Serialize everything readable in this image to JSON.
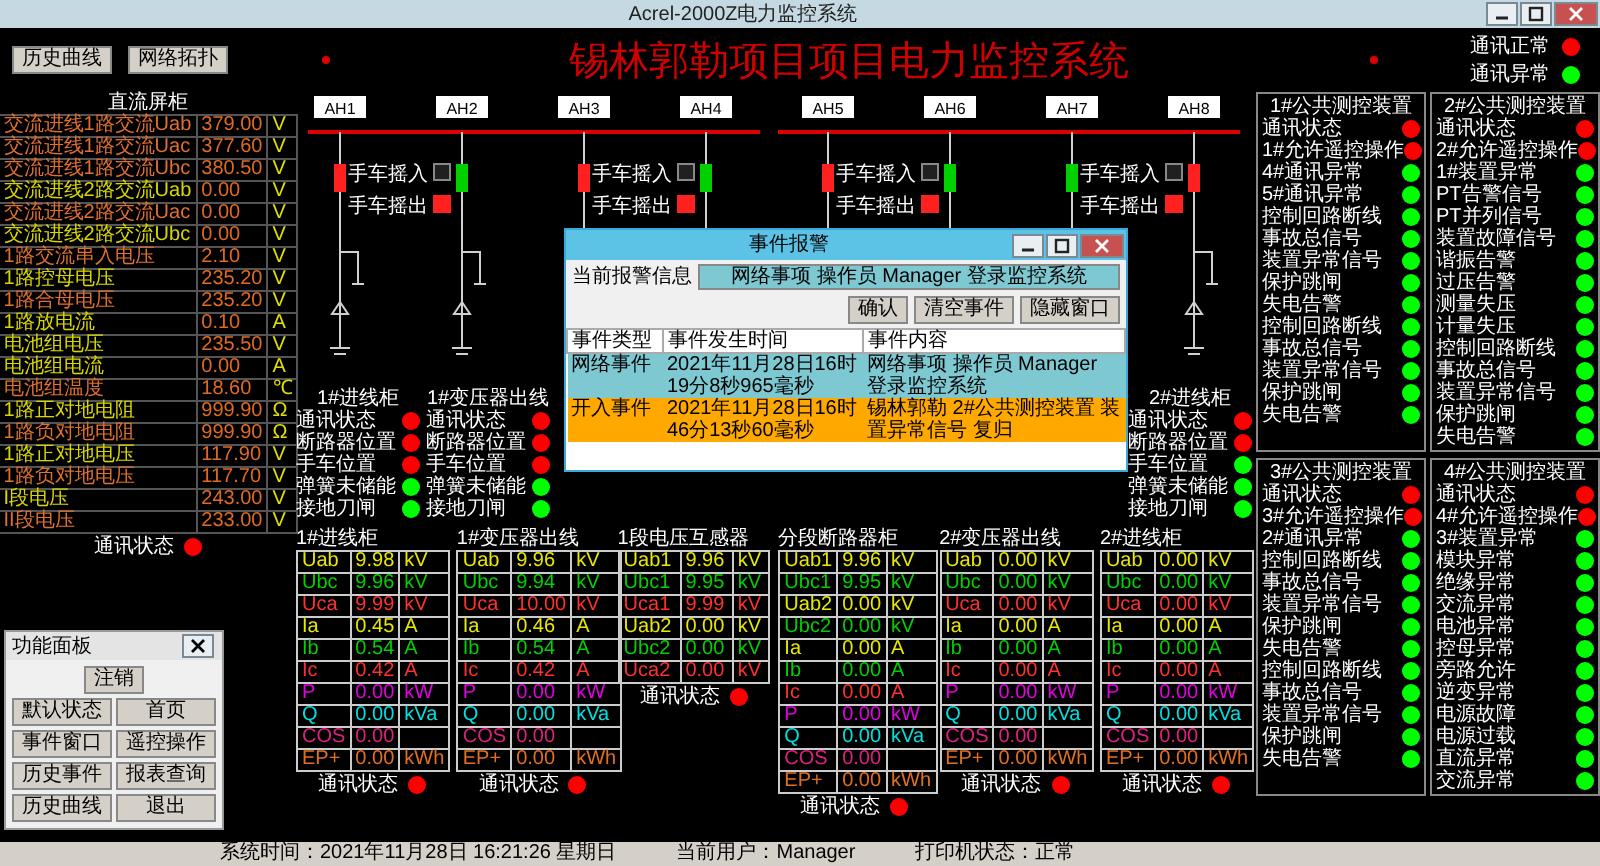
{
  "window": {
    "title": "Acrel-2000Z电力监控系统"
  },
  "toolbar": {
    "buttons": [
      "历史曲线",
      "网络拓扑"
    ]
  },
  "header": {
    "title": "锡林郭勒项目项目电力监控系统",
    "legend": [
      {
        "label": "通讯正常",
        "color": "#ff0000"
      },
      {
        "label": "通讯异常",
        "color": "#00ff00"
      }
    ]
  },
  "dc_panel": {
    "title": "直流屏柜",
    "rows": [
      {
        "label": "交流进线1路交流Uab",
        "value": "379.00",
        "unit": "V",
        "color": "#e07030"
      },
      {
        "label": "交流进线1路交流Uac",
        "value": "377.60",
        "unit": "V",
        "color": "#e07030"
      },
      {
        "label": "交流进线1路交流Ubc",
        "value": "380.50",
        "unit": "V",
        "color": "#e07030"
      },
      {
        "label": "交流进线2路交流Uab",
        "value": "0.00",
        "unit": "V",
        "color": "#d8d800"
      },
      {
        "label": "交流进线2路交流Uac",
        "value": "0.00",
        "unit": "V",
        "color": "#e07030"
      },
      {
        "label": "交流进线2路交流Ubc",
        "value": "0.00",
        "unit": "V",
        "color": "#d8d800"
      },
      {
        "label": "1路交流串入电压",
        "value": "2.10",
        "unit": "V",
        "color": "#e07030"
      },
      {
        "label": "1路控母电压",
        "value": "235.20",
        "unit": "V",
        "color": "#d8d800"
      },
      {
        "label": "1路合母电压",
        "value": "235.20",
        "unit": "V",
        "color": "#e07030"
      },
      {
        "label": "1路放电流",
        "value": "0.10",
        "unit": "A",
        "color": "#d8d800"
      },
      {
        "label": "电池组电压",
        "value": "235.50",
        "unit": "V",
        "color": "#d8d800"
      },
      {
        "label": "电池组电流",
        "value": "0.00",
        "unit": "A",
        "color": "#d8d800"
      },
      {
        "label": "电池组温度",
        "value": "18.60",
        "unit": "℃",
        "color": "#e07030"
      },
      {
        "label": "1路正对地电阻",
        "value": "999.90",
        "unit": "Ω",
        "color": "#d8d800"
      },
      {
        "label": "1路负对地电阻",
        "value": "999.90",
        "unit": "Ω",
        "color": "#e07030"
      },
      {
        "label": "1路正对地电压",
        "value": "117.90",
        "unit": "V",
        "color": "#d8d800"
      },
      {
        "label": "1路负对地电压",
        "value": "117.70",
        "unit": "V",
        "color": "#e07030"
      },
      {
        "label": "I段电压",
        "value": "243.00",
        "unit": "V",
        "color": "#d8d800"
      },
      {
        "label": "II段电压",
        "value": "233.00",
        "unit": "V",
        "color": "#e07030"
      }
    ],
    "status": {
      "label": "通讯状态",
      "color": "#ff0000"
    }
  },
  "function_panel": {
    "title": "功能面板",
    "buttons": [
      "注销",
      "默认状态",
      "首页",
      "事件窗口",
      "遥控操作",
      "历史事件",
      "报表查询",
      "历史曲线",
      "退出"
    ]
  },
  "diagram": {
    "cabinets": [
      {
        "label": "AH1",
        "closed": true
      },
      {
        "label": "AH2",
        "closed": false,
        "handcart": [
          {
            "label": "手车摇入",
            "on": false
          },
          {
            "label": "手车摇出",
            "on": true
          }
        ]
      },
      {
        "label": "AH3",
        "closed": true
      },
      {
        "label": "AH4",
        "closed": false,
        "handcart": [
          {
            "label": "手车摇入",
            "on": false
          },
          {
            "label": "手车摇出",
            "on": true
          }
        ]
      },
      {
        "label": "AH5",
        "closed": true
      },
      {
        "label": "AH6",
        "closed": false,
        "handcart": [
          {
            "label": "手车摇入",
            "on": false
          },
          {
            "label": "手车摇出",
            "on": true
          }
        ]
      },
      {
        "label": "AH7",
        "closed": false
      },
      {
        "label": "AH8",
        "closed": true,
        "handcart": [
          {
            "label": "手车摇入",
            "on": false
          },
          {
            "label": "手车摇出",
            "on": true
          }
        ]
      }
    ]
  },
  "cabinet_status": [
    {
      "title": "1#进线柜",
      "items": [
        {
          "label": "通讯状态",
          "color": "#ff0000"
        },
        {
          "label": "断路器位置",
          "color": "#ff0000"
        },
        {
          "label": "手车位置",
          "color": "#ff0000"
        },
        {
          "label": "弹簧未储能",
          "color": "#00ff00"
        },
        {
          "label": "接地刀闸",
          "color": "#00ff00"
        }
      ]
    },
    {
      "title": "1#变压器出线",
      "items": [
        {
          "label": "通讯状态",
          "color": "#ff0000"
        },
        {
          "label": "断路器位置",
          "color": "#ff0000"
        },
        {
          "label": "手车位置",
          "color": "#ff0000"
        },
        {
          "label": "弹簧未储能",
          "color": "#00ff00"
        },
        {
          "label": "接地刀闸",
          "color": "#00ff00"
        }
      ]
    },
    {
      "title": "2#进线柜",
      "items": [
        {
          "label": "通讯状态",
          "color": "#ff0000"
        },
        {
          "label": "断路器位置",
          "color": "#ff0000"
        },
        {
          "label": "手车位置",
          "color": "#00ff00"
        },
        {
          "label": "弹簧未储能",
          "color": "#00ff00"
        },
        {
          "label": "接地刀闸",
          "color": "#00ff00"
        }
      ]
    }
  ],
  "meters": [
    {
      "title": "1#进线柜",
      "rows": [
        {
          "name": "Uab",
          "value": "9.98",
          "unit": "kV",
          "color": "#e8e800"
        },
        {
          "name": "Ubc",
          "value": "9.96",
          "unit": "kV",
          "color": "#00d000"
        },
        {
          "name": "Uca",
          "value": "9.99",
          "unit": "kV",
          "color": "#ff3030"
        },
        {
          "name": "Ia",
          "value": "0.45",
          "unit": "A",
          "color": "#e8e800"
        },
        {
          "name": "Ib",
          "value": "0.54",
          "unit": "A",
          "color": "#00d000"
        },
        {
          "name": "Ic",
          "value": "0.42",
          "unit": "A",
          "color": "#ff3030"
        },
        {
          "name": "P",
          "value": "0.00",
          "unit": "kW",
          "color": "#e000e0"
        },
        {
          "name": "Q",
          "value": "0.00",
          "unit": "kVa",
          "color": "#00e0e0"
        },
        {
          "name": "COS",
          "value": "0.00",
          "color": "#e02080"
        }
      ],
      "energy": {
        "name": "EP+",
        "value": "0.00",
        "unit": "kWh"
      },
      "status": {
        "label": "通讯状态",
        "color": "#ff0000"
      }
    },
    {
      "title": "1#变压器出线",
      "rows": [
        {
          "name": "Uab",
          "value": "9.96",
          "unit": "kV",
          "color": "#e8e800"
        },
        {
          "name": "Ubc",
          "value": "9.94",
          "unit": "kV",
          "color": "#00d000"
        },
        {
          "name": "Uca",
          "value": "10.00",
          "unit": "kV",
          "color": "#ff3030"
        },
        {
          "name": "Ia",
          "value": "0.46",
          "unit": "A",
          "color": "#e8e800"
        },
        {
          "name": "Ib",
          "value": "0.54",
          "unit": "A",
          "color": "#00d000"
        },
        {
          "name": "Ic",
          "value": "0.42",
          "unit": "A",
          "color": "#ff3030"
        },
        {
          "name": "P",
          "value": "0.00",
          "unit": "kW",
          "color": "#e000e0"
        },
        {
          "name": "Q",
          "value": "0.00",
          "unit": "kVa",
          "color": "#00e0e0"
        },
        {
          "name": "COS",
          "value": "0.00",
          "color": "#e02080"
        }
      ],
      "energy": {
        "name": "EP+",
        "value": "0.00",
        "unit": "kWh"
      },
      "status": {
        "label": "通讯状态",
        "color": "#ff0000"
      }
    },
    {
      "title": "1段电压互感器",
      "rows": [
        {
          "name": "Uab1",
          "value": "9.96",
          "unit": "kV",
          "color": "#e8e800"
        },
        {
          "name": "Ubc1",
          "value": "9.95",
          "unit": "kV",
          "color": "#00d000"
        },
        {
          "name": "Uca1",
          "value": "9.99",
          "unit": "kV",
          "color": "#ff3030"
        },
        {
          "name": "Uab2",
          "value": "0.00",
          "unit": "kV",
          "color": "#e8e800"
        },
        {
          "name": "Ubc2",
          "value": "0.00",
          "unit": "kV",
          "color": "#00d000"
        },
        {
          "name": "Uca2",
          "value": "0.00",
          "unit": "kV",
          "color": "#ff3030"
        }
      ],
      "status": {
        "label": "通讯状态",
        "color": "#ff0000"
      }
    },
    {
      "title": "分段断路器柜",
      "rows": [
        {
          "name": "Uab1",
          "value": "9.96",
          "unit": "kV",
          "color": "#e8e800"
        },
        {
          "name": "Ubc1",
          "value": "9.95",
          "unit": "kV",
          "color": "#00d000"
        },
        {
          "name": "Uab2",
          "value": "0.00",
          "unit": "kV",
          "color": "#e8e800"
        },
        {
          "name": "Ubc2",
          "value": "0.00",
          "unit": "kV",
          "color": "#00d000"
        },
        {
          "name": "Ia",
          "value": "0.00",
          "unit": "A",
          "color": "#e8e800"
        },
        {
          "name": "Ib",
          "value": "0.00",
          "unit": "A",
          "color": "#00d000"
        },
        {
          "name": "Ic",
          "value": "0.00",
          "unit": "A",
          "color": "#ff3030"
        },
        {
          "name": "P",
          "value": "0.00",
          "unit": "kW",
          "color": "#e000e0"
        },
        {
          "name": "Q",
          "value": "0.00",
          "unit": "kVa",
          "color": "#00e0e0"
        },
        {
          "name": "COS",
          "value": "0.00",
          "color": "#e02080"
        }
      ],
      "energy": {
        "name": "EP+",
        "value": "0.00",
        "unit": "kWh"
      },
      "status": {
        "label": "通讯状态",
        "color": "#ff0000"
      }
    },
    {
      "title": "2#变压器出线",
      "rows": [
        {
          "name": "Uab",
          "value": "0.00",
          "unit": "kV",
          "color": "#e8e800"
        },
        {
          "name": "Ubc",
          "value": "0.00",
          "unit": "kV",
          "color": "#00d000"
        },
        {
          "name": "Uca",
          "value": "0.00",
          "unit": "kV",
          "color": "#ff3030"
        },
        {
          "name": "Ia",
          "value": "0.00",
          "unit": "A",
          "color": "#e8e800"
        },
        {
          "name": "Ib",
          "value": "0.00",
          "unit": "A",
          "color": "#00d000"
        },
        {
          "name": "Ic",
          "value": "0.00",
          "unit": "A",
          "color": "#ff3030"
        },
        {
          "name": "P",
          "value": "0.00",
          "unit": "kW",
          "color": "#e000e0"
        },
        {
          "name": "Q",
          "value": "0.00",
          "unit": "kVa",
          "color": "#00e0e0"
        },
        {
          "name": "COS",
          "value": "0.00",
          "color": "#e02080"
        }
      ],
      "energy": {
        "name": "EP+",
        "value": "0.00",
        "unit": "kWh"
      },
      "status": {
        "label": "通讯状态",
        "color": "#ff0000"
      }
    },
    {
      "title": "2#进线柜",
      "rows": [
        {
          "name": "Uab",
          "value": "0.00",
          "unit": "kV",
          "color": "#e8e800"
        },
        {
          "name": "Ubc",
          "value": "0.00",
          "unit": "kV",
          "color": "#00d000"
        },
        {
          "name": "Uca",
          "value": "0.00",
          "unit": "kV",
          "color": "#ff3030"
        },
        {
          "name": "Ia",
          "value": "0.00",
          "unit": "A",
          "color": "#e8e800"
        },
        {
          "name": "Ib",
          "value": "0.00",
          "unit": "A",
          "color": "#00d000"
        },
        {
          "name": "Ic",
          "value": "0.00",
          "unit": "A",
          "color": "#ff3030"
        },
        {
          "name": "P",
          "value": "0.00",
          "unit": "kW",
          "color": "#e000e0"
        },
        {
          "name": "Q",
          "value": "0.00",
          "unit": "kVa",
          "color": "#00e0e0"
        },
        {
          "name": "COS",
          "value": "0.00",
          "color": "#e02080"
        }
      ],
      "energy": {
        "name": "EP+",
        "value": "0.00",
        "unit": "kWh"
      },
      "status": {
        "label": "通讯状态",
        "color": "#ff0000"
      }
    }
  ],
  "event_dialog": {
    "title": "事件报警",
    "current_label": "当前报警信息",
    "current_value": "网络事项 操作员 Manager 登录监控系统",
    "buttons": [
      "确认",
      "清空事件",
      "隐藏窗口"
    ],
    "columns": [
      "事件类型",
      "事件发生时间",
      "事件内容"
    ],
    "rows": [
      {
        "cells": [
          "网络事件",
          "2021年11月28日16时19分8秒965毫秒",
          "网络事项 操作员 Manager 登录监控系统"
        ],
        "color": "#7ec8d2"
      },
      {
        "cells": [
          "开入事件",
          "2021年11月28日16时46分13秒60毫秒",
          "锡林郭勒 2#公共测控装置 装置异常信号 复归"
        ],
        "color": "#ffa800"
      }
    ]
  },
  "device_panels": [
    {
      "title": "1#公共测控装置",
      "items": [
        {
          "label": "通讯状态",
          "color": "#ff0000"
        },
        {
          "label": "1#允许遥控操作",
          "color": "#ff0000"
        },
        {
          "label": "4#通讯异常",
          "color": "#00ff00"
        },
        {
          "label": "5#通讯异常",
          "color": "#00ff00"
        },
        {
          "label": "控制回路断线",
          "color": "#00ff00"
        },
        {
          "label": "事故总信号",
          "color": "#00ff00"
        },
        {
          "label": "装置异常信号",
          "color": "#00ff00"
        },
        {
          "label": "保护跳闸",
          "color": "#00ff00"
        },
        {
          "label": "失电告警",
          "color": "#00ff00"
        },
        {
          "label": "控制回路断线",
          "color": "#00ff00"
        },
        {
          "label": "事故总信号",
          "color": "#00ff00"
        },
        {
          "label": "装置异常信号",
          "color": "#00ff00"
        },
        {
          "label": "保护跳闸",
          "color": "#00ff00"
        },
        {
          "label": "失电告警",
          "color": "#00ff00"
        }
      ]
    },
    {
      "title": "2#公共测控装置",
      "items": [
        {
          "label": "通讯状态",
          "color": "#ff0000"
        },
        {
          "label": "2#允许遥控操作",
          "color": "#ff0000"
        },
        {
          "label": "1#装置异常",
          "color": "#00ff00"
        },
        {
          "label": "PT告警信号",
          "color": "#00ff00"
        },
        {
          "label": "PT并列信号",
          "color": "#00ff00"
        },
        {
          "label": "装置故障信号",
          "color": "#00ff00"
        },
        {
          "label": "谐振告警",
          "color": "#00ff00"
        },
        {
          "label": "过压告警",
          "color": "#00ff00"
        },
        {
          "label": "测量失压",
          "color": "#00ff00"
        },
        {
          "label": "计量失压",
          "color": "#00ff00"
        },
        {
          "label": "控制回路断线",
          "color": "#00ff00"
        },
        {
          "label": "事故总信号",
          "color": "#00ff00"
        },
        {
          "label": "装置异常信号",
          "color": "#00ff00"
        },
        {
          "label": "保护跳闸",
          "color": "#00ff00"
        },
        {
          "label": "失电告警",
          "color": "#00ff00"
        }
      ]
    },
    {
      "title": "3#公共测控装置",
      "items": [
        {
          "label": "通讯状态",
          "color": "#ff0000"
        },
        {
          "label": "3#允许遥控操作",
          "color": "#ff0000"
        },
        {
          "label": "2#通讯异常",
          "color": "#00ff00"
        },
        {
          "label": "控制回路断线",
          "color": "#00ff00"
        },
        {
          "label": "事故总信号",
          "color": "#00ff00"
        },
        {
          "label": "装置异常信号",
          "color": "#00ff00"
        },
        {
          "label": "保护跳闸",
          "color": "#00ff00"
        },
        {
          "label": "失电告警",
          "color": "#00ff00"
        },
        {
          "label": "控制回路断线",
          "color": "#00ff00"
        },
        {
          "label": "事故总信号",
          "color": "#00ff00"
        },
        {
          "label": "装置异常信号",
          "color": "#00ff00"
        },
        {
          "label": "保护跳闸",
          "color": "#00ff00"
        },
        {
          "label": "失电告警",
          "color": "#00ff00"
        }
      ]
    },
    {
      "title": "4#公共测控装置",
      "items": [
        {
          "label": "通讯状态",
          "color": "#ff0000"
        },
        {
          "label": "4#允许遥控操作",
          "color": "#ff0000"
        },
        {
          "label": "3#装置异常",
          "color": "#00ff00"
        },
        {
          "label": "模块异常",
          "color": "#00ff00"
        },
        {
          "label": "绝缘异常",
          "color": "#00ff00"
        },
        {
          "label": "交流异常",
          "color": "#00ff00"
        },
        {
          "label": "电池异常",
          "color": "#00ff00"
        },
        {
          "label": "控母异常",
          "color": "#00ff00"
        },
        {
          "label": "旁路允许",
          "color": "#00ff00"
        },
        {
          "label": "逆变异常",
          "color": "#00ff00"
        },
        {
          "label": "电源故障",
          "color": "#00ff00"
        },
        {
          "label": "电源过载",
          "color": "#00ff00"
        },
        {
          "label": "直流异常",
          "color": "#00ff00"
        },
        {
          "label": "交流异常",
          "color": "#00ff00"
        }
      ]
    }
  ],
  "status_bar": [
    "系统时间：2021年11月28日 16:21:26 星期日",
    "当前用户：Manager",
    "打印机状态：正常"
  ]
}
